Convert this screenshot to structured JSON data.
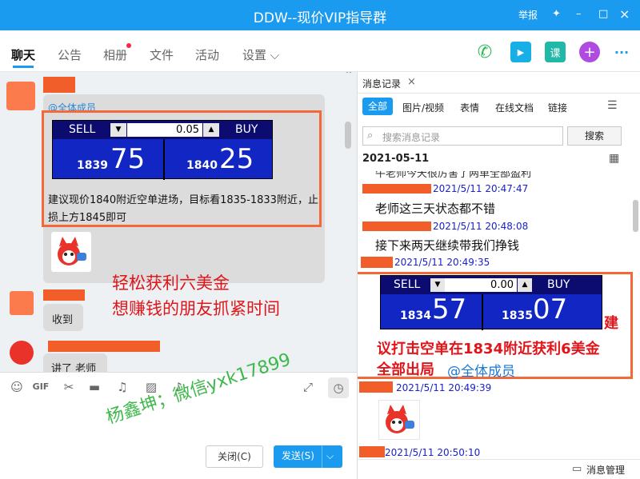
{
  "window": {
    "title": "DDW--现价VIP指导群",
    "report": "举报",
    "minimize": "–",
    "maximize": "□",
    "close": "×"
  },
  "tabs": [
    {
      "label": "聊天"
    },
    {
      "label": "公告"
    },
    {
      "label": "相册"
    },
    {
      "label": "文件"
    },
    {
      "label": "活动"
    },
    {
      "label": "设置 ⌵"
    }
  ],
  "toolbar_icons": {
    "call": "✆",
    "video": "▶",
    "course": "课",
    "add": "+",
    "more": "···"
  },
  "chat": {
    "mention": "@全体成员",
    "ticket1": {
      "sell": "SELL",
      "buy": "BUY",
      "lots": "0.05",
      "sell_small": "1839",
      "sell_big": "75",
      "buy_small": "1840",
      "buy_big": "25"
    },
    "advice": "建议现价1840附近空单进场，目标看1835-1833附近，止损上方1845即可",
    "overlay1": "轻松获利六美金",
    "overlay2": "想赚钱的朋友抓紧时间",
    "reply1": "收到",
    "reply2": "讲了 老师"
  },
  "input": {
    "close": "关闭(C)",
    "send": "发送(S)",
    "watermark": "杨鑫坤；微信yxk17899"
  },
  "history": {
    "panel_title": "消息记录",
    "panel_close": "×",
    "filters": [
      "全部",
      "图片/视频",
      "表情",
      "在线文档",
      "链接"
    ],
    "search_placeholder": "搜索消息记录",
    "search_button": "搜索",
    "date": "2021-05-11",
    "partial_text": "牛老师今天很厉害了两单全部盈利",
    "messages": [
      {
        "time": "2021/5/11 20:47:47",
        "text": "老师这三天状态都不错"
      },
      {
        "time": "2021/5/11 20:48:08",
        "text": "接下来两天继续带我们挣钱"
      },
      {
        "time": "2021/5/11 20:49:35",
        "text": ""
      }
    ],
    "ticket2": {
      "sell": "SELL",
      "buy": "BUY",
      "lots": "0.00",
      "sell_small": "1834",
      "sell_big": "57",
      "buy_small": "1835",
      "buy_big": "07"
    },
    "overlay_a": "建",
    "overlay_b": "议打击空单在1834附近获利6美金",
    "overlay_c": "全部出局",
    "overlay_mention": "@全体成员",
    "time4": "2021/5/11 20:49:39",
    "time5": "2021/5/11 20:50:10",
    "manage": "消息管理"
  }
}
